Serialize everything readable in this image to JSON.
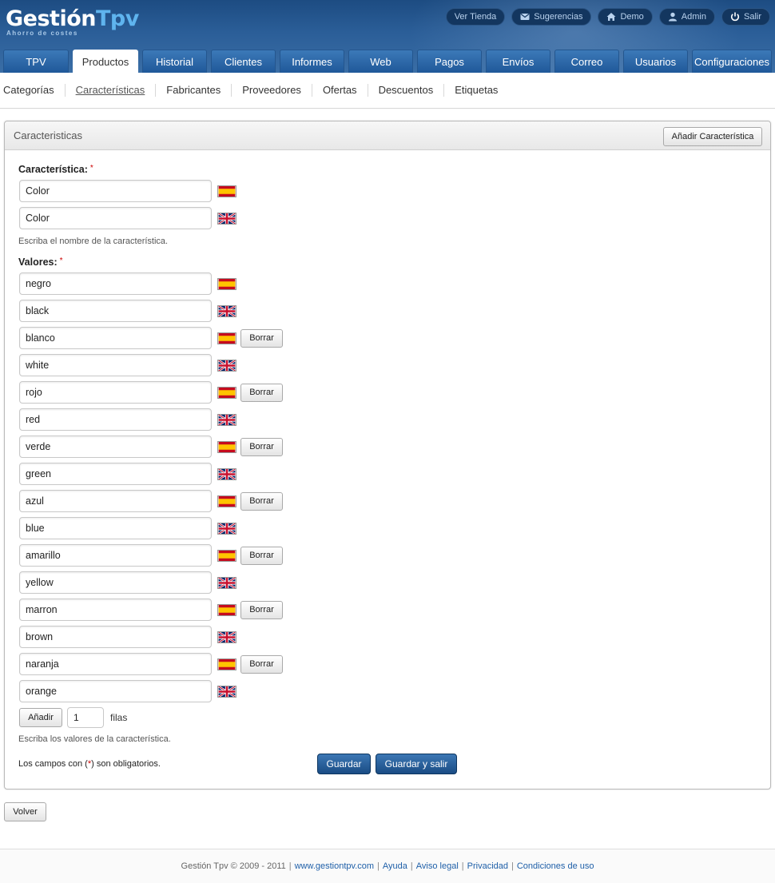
{
  "header": {
    "logo_main": "Gestión",
    "logo_accent": "Tpv",
    "logo_tagline": "Ahorro de costes",
    "top_links": [
      {
        "label": "Ver Tienda",
        "icon": "none"
      },
      {
        "label": "Sugerencias",
        "icon": "envelope-icon"
      },
      {
        "label": "Demo",
        "icon": "home-icon"
      },
      {
        "label": "Admin",
        "icon": "user-icon"
      },
      {
        "label": "Salir",
        "icon": "power-icon"
      }
    ],
    "tabs": [
      "TPV",
      "Productos",
      "Historial",
      "Clientes",
      "Informes",
      "Web",
      "Pagos",
      "Envíos",
      "Correo",
      "Usuarios",
      "Configuraciones"
    ],
    "active_tab": "Productos"
  },
  "subnav": {
    "items": [
      "Categorías",
      "Características",
      "Fabricantes",
      "Proveedores",
      "Ofertas",
      "Descuentos",
      "Etiquetas"
    ],
    "active": "Características"
  },
  "panel": {
    "title": "Caracteristicas",
    "add_button": "Añadir Característica",
    "feature_label": "Característica:",
    "required_mark": "*",
    "feature_names": [
      {
        "lang": "es",
        "value": "Color"
      },
      {
        "lang": "en",
        "value": "Color"
      }
    ],
    "feature_hint": "Escriba el nombre de la característica.",
    "values_label": "Valores:",
    "values": [
      {
        "es": "negro",
        "en": "black",
        "deletable": false
      },
      {
        "es": "blanco",
        "en": "white",
        "deletable": true
      },
      {
        "es": "rojo",
        "en": "red",
        "deletable": true
      },
      {
        "es": "verde",
        "en": "green",
        "deletable": true
      },
      {
        "es": "azul",
        "en": "blue",
        "deletable": true
      },
      {
        "es": "amarillo",
        "en": "yellow",
        "deletable": true
      },
      {
        "es": "marron",
        "en": "brown",
        "deletable": true
      },
      {
        "es": "naranja",
        "en": "orange",
        "deletable": true
      }
    ],
    "delete_label": "Borrar",
    "add_rows_button": "Añadir",
    "add_rows_count": "1",
    "add_rows_suffix": "filas",
    "values_hint": "Escriba los valores de la característica.",
    "required_note_prefix": "Los campos con (",
    "required_note_star": "*",
    "required_note_suffix": ") son obligatorios.",
    "save_button": "Guardar",
    "save_exit_button": "Guardar y salir"
  },
  "back_button": "Volver",
  "footer": {
    "copyright": "Gestión Tpv © 2009 - 2011",
    "links": [
      "www.gestiontpv.com",
      "Ayuda",
      "Aviso legal",
      "Privacidad",
      "Condiciones de uso"
    ]
  },
  "colors": {
    "header_blue": "#2b5e98",
    "button_blue": "#1a4c84",
    "link_blue": "#1e5fa8",
    "required_red": "#cc0000"
  }
}
